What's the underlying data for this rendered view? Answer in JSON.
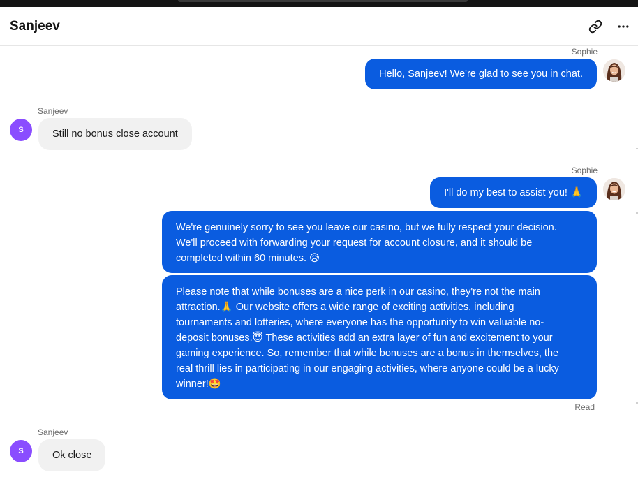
{
  "header": {
    "title": "Sanjeev",
    "link_icon": "link-icon",
    "more_icon": "more-horizontal-icon"
  },
  "messages": [
    {
      "sender": "Sophie",
      "text": "Hello, Sanjeev! We're glad to see you in chat."
    },
    {
      "sender": "Sanjeev",
      "avatar_initial": "S",
      "text": "Still no bonus close account"
    },
    {
      "sender": "Sophie",
      "text": "I'll do my best to assist you! 🙏"
    },
    {
      "lines": [
        "We're genuinely sorry to see you leave our casino, but we fully respect your decision.",
        "We'll proceed with forwarding your request for account closure, and it should be",
        "completed within 60 minutes. 😥"
      ]
    },
    {
      "lines": [
        "Please note that while bonuses are a nice perk in our casino, they're not the main",
        "attraction.🙏 Our website offers a wide range of exciting activities, including",
        "tournaments and lotteries, where everyone has the opportunity to win valuable no-",
        "deposit bonuses.😇 These activities add an extra layer of fun and excitement to your",
        "gaming experience. So, remember that while bonuses are a bonus in themselves, the",
        "real thrill lies in participating in our engaging activities, where anyone could be a lucky",
        "winner!🤩"
      ],
      "status": "Read"
    },
    {
      "sender": "Sanjeev",
      "avatar_initial": "S",
      "text": "Ok close"
    }
  ],
  "colors": {
    "outgoing_bubble": "#0a5ce0",
    "incoming_bubble": "#f1f1f1",
    "user_avatar": "#8a4dff"
  }
}
